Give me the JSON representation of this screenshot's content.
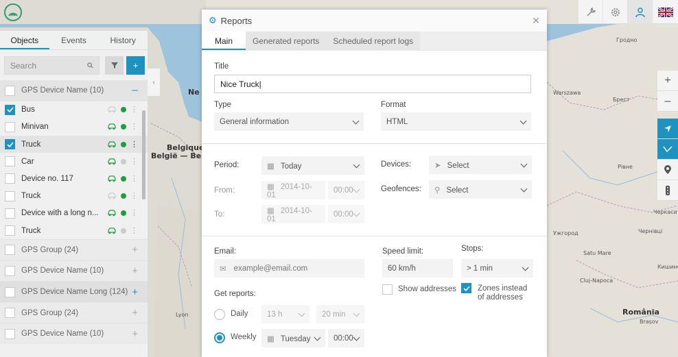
{
  "map": {
    "labels": [
      "Ne",
      "Belgique –",
      "België — Belgien",
      "Lyon",
      "Warszawa",
      "Брест",
      "Гродно",
      "Рівне",
      "Черкаси",
      "Чернівці",
      "Ужгород",
      "Cluj-Napoca",
      "Satu Mare",
      "România",
      "Brașov",
      "Кишинёв"
    ]
  },
  "topbar": {
    "icons": [
      "wrench-icon",
      "gear-icon",
      "user-icon",
      "flag-icon"
    ]
  },
  "sidebar": {
    "tabs": [
      "Objects",
      "Events",
      "History"
    ],
    "search_placeholder": "Search",
    "group_header": "GPS Device Name (10)",
    "devices": [
      {
        "name": "Bus",
        "checked": true,
        "status": "online"
      },
      {
        "name": "Minivan",
        "checked": false,
        "status": "online"
      },
      {
        "name": "Truck",
        "checked": true,
        "status": "online"
      },
      {
        "name": "Car",
        "checked": false,
        "status": "offline"
      },
      {
        "name": "Device no. 117",
        "checked": false,
        "status": "online"
      },
      {
        "name": "Truck",
        "checked": false,
        "status": "online"
      },
      {
        "name": "Device with a long n...",
        "checked": false,
        "status": "online"
      },
      {
        "name": "Truck",
        "checked": false,
        "status": "offline"
      }
    ],
    "groups": [
      "GPS Group (24)",
      "GPS Device Name (10)",
      "GPS Device Name Long (124)",
      "GPS Group (24)",
      "GPS Device Name (10)"
    ]
  },
  "modal": {
    "title": "Reports",
    "tabs": [
      "Main",
      "Generated reports",
      "Scheduled report logs"
    ],
    "title_label": "Title",
    "title_value": "Nice Truck|",
    "type_label": "Type",
    "type_value": "General information",
    "format_label": "Format",
    "format_value": "HTML",
    "period_label": "Period:",
    "period_value": "Today",
    "from_label": "From:",
    "from_date": "2014-10-01",
    "from_time": "00:00",
    "to_label": "To:",
    "to_date": "2014-10-01",
    "to_time": "00:00",
    "devices_label": "Devices:",
    "devices_value": "Select",
    "geofences_label": "Geofences:",
    "geofences_value": "Select",
    "email_label": "Email:",
    "email_placeholder": "example@email.com",
    "speed_label": "Speed limit:",
    "speed_value": "60 km/h",
    "stops_label": "Stops:",
    "stops_value": "> 1 min",
    "show_addresses": "Show addresses",
    "zones_instead_1": "Zones instead",
    "zones_instead_2": "of addresses",
    "get_reports_label": "Get reports:",
    "daily_label": "Daily",
    "daily_hour": "13 h",
    "daily_min": "20 min",
    "weekly_label": "Weekly",
    "weekly_day": "Tuesday",
    "weekly_time": "00:00"
  },
  "colors": {
    "accent": "#1f93bf",
    "online": "#1e9e3e",
    "offline": "#cccccc"
  }
}
